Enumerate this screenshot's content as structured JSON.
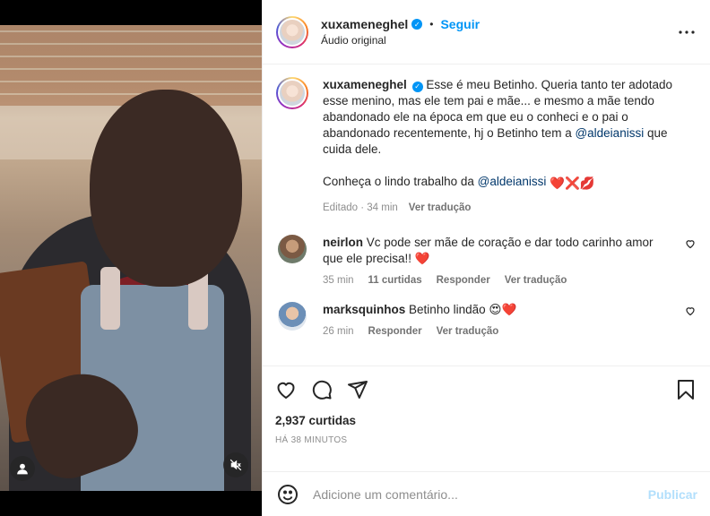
{
  "header": {
    "username": "xuxameneghel",
    "separator": "•",
    "follow_label": "Seguir",
    "audio_label": "Áudio original",
    "more_icon": "more-options-icon"
  },
  "caption": {
    "username": "xuxameneghel",
    "text_part1": "Esse é meu Betinho. Queria tanto ter adotado esse menino, mas ele tem pai e mãe... e mesmo a mãe tendo abandonado ele na época em que eu o conheci e o pai o abandonado recentemente, hj o Betinho tem a ",
    "mention1": "@aldeianissi",
    "text_part2": " que cuida dele.",
    "text_p2": "Conheça o lindo trabalho da ",
    "mention2": "@aldeianissi",
    "emojis": "❤️❌💋",
    "edited_label": "Editado",
    "time": "34 min",
    "translate_label": "Ver tradução"
  },
  "comments": [
    {
      "username": "neirlon",
      "text": "Vc pode ser mãe de coração e dar todo carinho amor que ele precisa!!",
      "emoji": "❤️",
      "time": "35 min",
      "likes": "11 curtidas",
      "reply_label": "Responder",
      "translate_label": "Ver tradução"
    },
    {
      "username": "marksquinhos",
      "text": "Betinho lindão",
      "emoji": "😍❤️",
      "time": "26 min",
      "reply_label": "Responder",
      "translate_label": "Ver tradução"
    }
  ],
  "actions": {
    "likes_count": "2,937 curtidas",
    "time_ago": "HÁ 38 MINUTOS",
    "icons": [
      "heart-icon",
      "comment-icon",
      "share-icon",
      "bookmark-icon"
    ]
  },
  "add_comment": {
    "placeholder": "Adicione um comentário...",
    "publish_label": "Publicar"
  },
  "colors": {
    "accent_blue": "#0095f6",
    "publish_disabled": "#b2dffc",
    "muted_text": "#8e8e8e",
    "mention": "#00376b",
    "heart_red": "#ed4956"
  }
}
